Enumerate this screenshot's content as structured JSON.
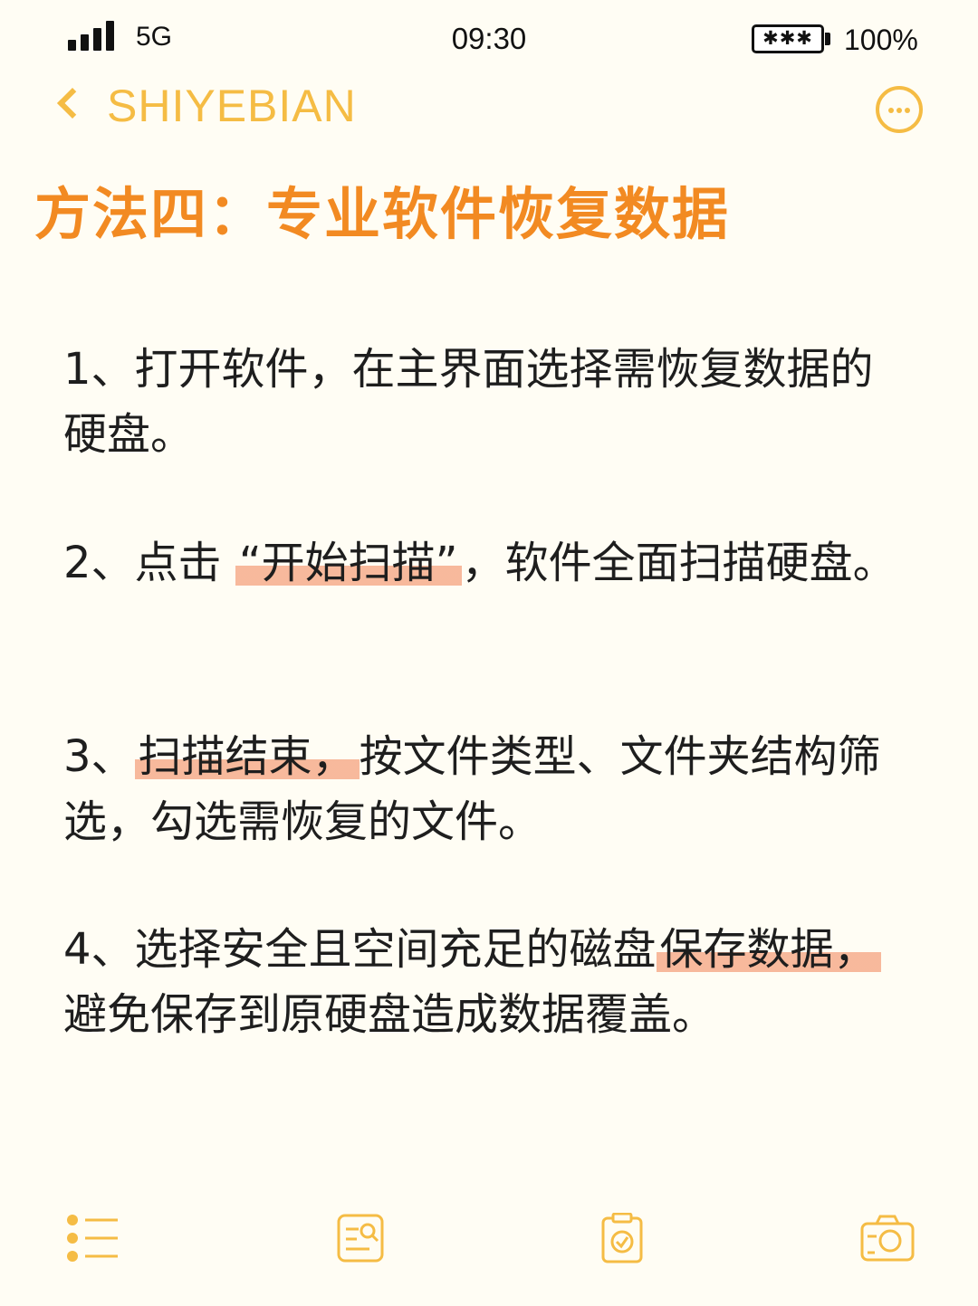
{
  "status_bar": {
    "network": "5G",
    "time": "09:30",
    "battery_glyphs": "✱✱✱",
    "battery_percent": "100%"
  },
  "nav": {
    "title": "SHIYEBIAN",
    "icons": [
      "chevron-left-icon",
      "more-icon"
    ]
  },
  "page": {
    "title": "方法四：专业软件恢复数据"
  },
  "steps": [
    {
      "segments": [
        "1、打开软件，在主界面选择需恢复数据的硬盘。"
      ]
    },
    {
      "before": "2、点击 ",
      "highlight": "“开始扫描”",
      "after": "，软件全面扫描硬盘。"
    },
    {
      "before": "3、",
      "highlight": "扫描结束，",
      "after": "按文件类型、文件夹结构筛选，勾选需恢复的文件。"
    },
    {
      "before": "4、选择安全且空间充足的磁盘",
      "highlight": "保存数据，",
      "after": "避免保存到原硬盘造成数据覆盖。"
    }
  ],
  "toolbar": {
    "icons": [
      "list-icon",
      "search-document-icon",
      "clipboard-check-icon",
      "camera-icon"
    ]
  },
  "colors": {
    "accent": "#f5bc44",
    "title": "#f28a22",
    "highlight": "#f6ad8c",
    "background": "#fffdf4"
  }
}
